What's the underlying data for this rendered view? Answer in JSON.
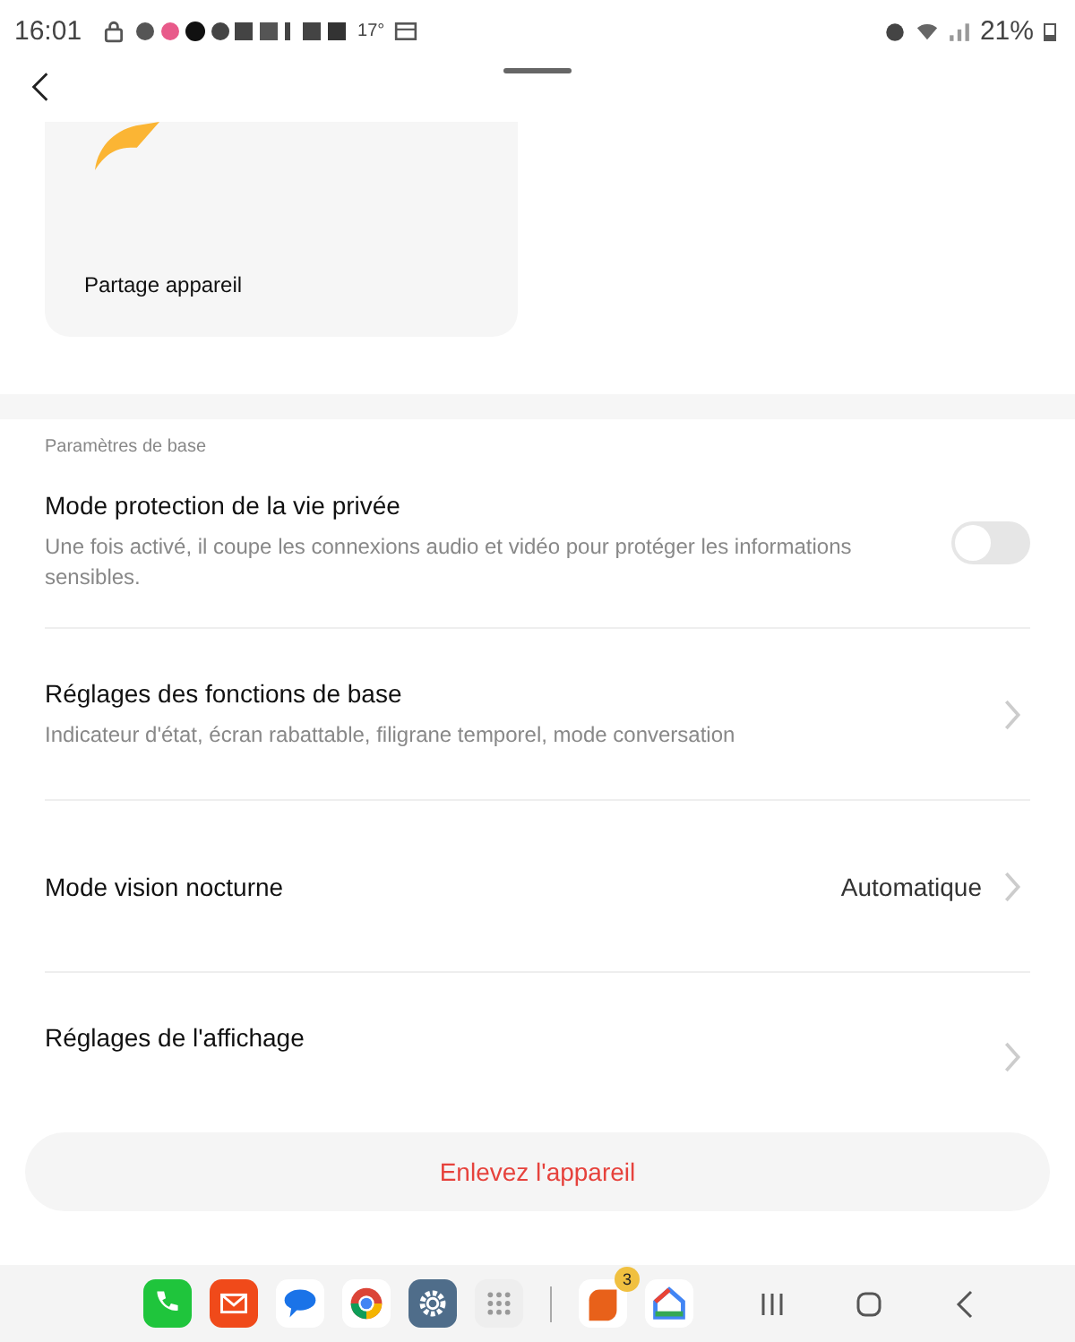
{
  "status_bar": {
    "time": "16:01",
    "temperature": "17°",
    "battery": "21%"
  },
  "card": {
    "label": "Partage appareil"
  },
  "section_label": "Paramètres de base",
  "rows": [
    {
      "kind": "toggle",
      "title": "Mode protection de la vie privée",
      "subtitle": "Une fois activé, il coupe les connexions audio et vidéo pour protéger les informations sensibles.",
      "on": false
    },
    {
      "kind": "link",
      "title": "Réglages des fonctions de base",
      "subtitle": "Indicateur d'état, écran rabattable, filigrane temporel, mode conversation"
    },
    {
      "kind": "value",
      "title": "Mode vision nocturne",
      "value": "Automatique"
    },
    {
      "kind": "link",
      "title": "Réglages de l'affichage"
    }
  ],
  "remove_button": "Enlevez l'appareil",
  "dock": {
    "badge": "3"
  }
}
